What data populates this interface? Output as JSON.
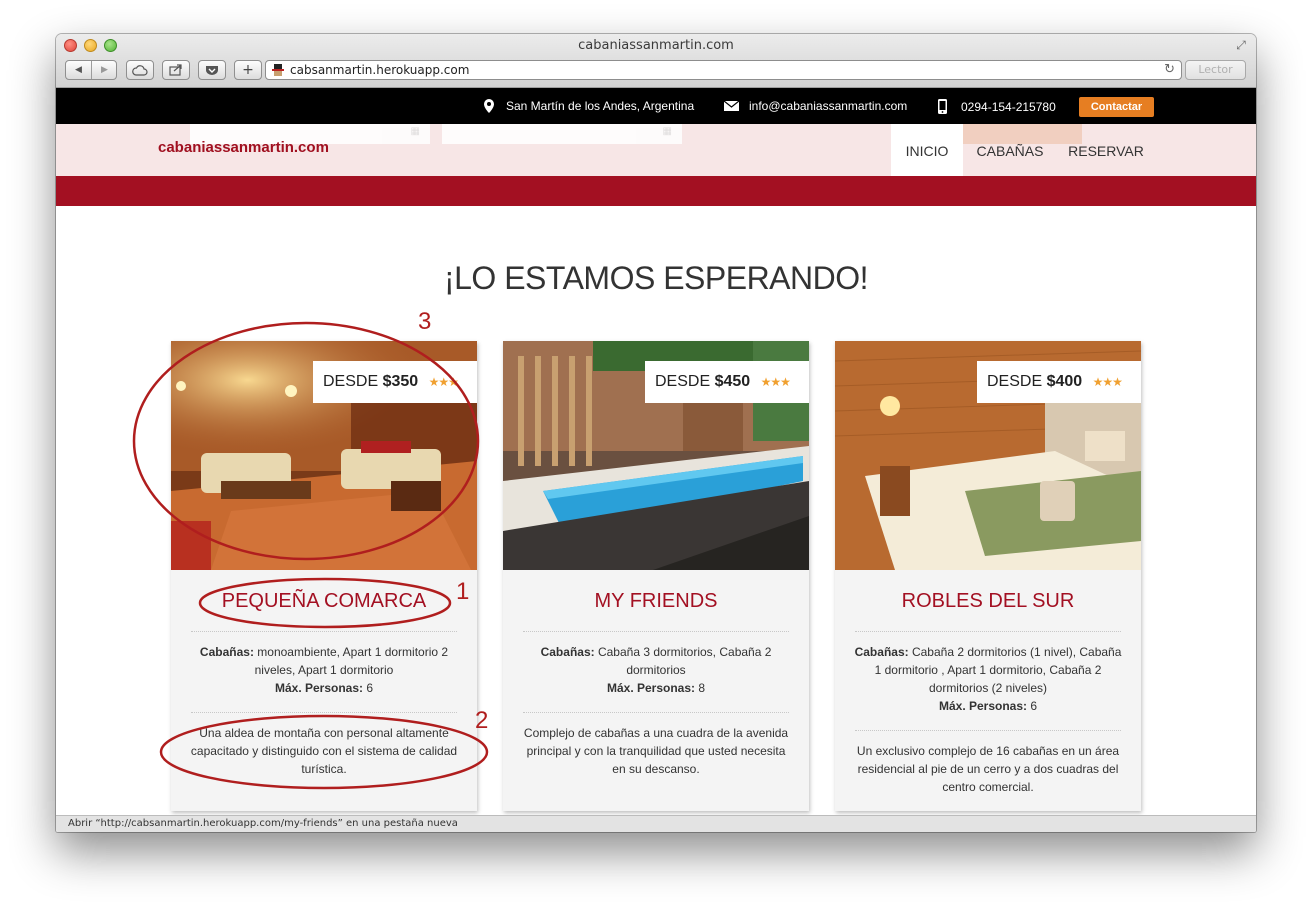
{
  "window": {
    "title": "cabaniassanmartin.com",
    "url": "cabsanmartin.herokuapp.com",
    "reader_label": "Lector"
  },
  "topbar": {
    "location": "San Martín de los Andes, Argentina",
    "email": "info@cabaniassanmartin.com",
    "phone": "0294-154-215780",
    "contact_label": "Contactar"
  },
  "header": {
    "logo": "cabaniassanmartin.com",
    "nav": [
      {
        "label": "INICIO",
        "active": true
      },
      {
        "label": "CABAÑAS",
        "active": false
      },
      {
        "label": "RESERVAR",
        "active": false
      }
    ]
  },
  "main": {
    "title": "¡LO ESTAMOS ESPERANDO!"
  },
  "cards": [
    {
      "price_prefix": "DESDE",
      "price": "$350",
      "stars": "★★★",
      "name": "PEQUEÑA COMARCA",
      "cabanas_label": "Cabañas:",
      "cabanas": " monoambiente, Apart 1 dormitorio 2 niveles, Apart 1 dormitorio",
      "personas_label": "Máx. Personas:",
      "personas": " 6",
      "description": "Una aldea de montaña con personal altamente capacitado y distinguido con el sistema de calidad turística."
    },
    {
      "price_prefix": "DESDE",
      "price": "$450",
      "stars": "★★★",
      "name": "MY FRIENDS",
      "cabanas_label": "Cabañas:",
      "cabanas": " Cabaña 3 dormitorios, Cabaña 2 dormitorios",
      "personas_label": "Máx. Personas:",
      "personas": " 8",
      "description": "Complejo de cabañas a una cuadra de la avenida principal y con la tranquilidad que usted necesita en su descanso."
    },
    {
      "price_prefix": "DESDE",
      "price": "$400",
      "stars": "★★★",
      "name": "ROBLES DEL SUR",
      "cabanas_label": "Cabañas:",
      "cabanas": " Cabaña 2 dormitorios (1 nivel), Cabaña 1 dormitorio , Apart 1 dormitorio, Cabaña 2 dormitorios (2 niveles)",
      "personas_label": "Máx. Personas:",
      "personas": " 6",
      "description": "Un exclusivo complejo de 16 cabañas en un área residencial al pie de un cerro y a dos cuadras del centro comercial."
    }
  ],
  "annotations": [
    "1",
    "2",
    "3"
  ],
  "statusbar": {
    "text": "Abrir “http://cabsanmartin.herokuapp.com/my-friends” en una pestaña nueva"
  },
  "colors": {
    "brand_red": "#a31022",
    "accent_orange": "#e67e22",
    "header_bg": "#f7e6e6",
    "topbar_bg": "#000000",
    "annotation_red": "#b01e1e"
  },
  "icons": [
    "location-pin-icon",
    "envelope-icon",
    "mobile-phone-icon",
    "back-icon",
    "forward-icon",
    "cloud-icon",
    "share-icon",
    "pocket-icon",
    "add-tab-icon",
    "reload-icon",
    "fullscreen-icon",
    "calendar-icon"
  ]
}
